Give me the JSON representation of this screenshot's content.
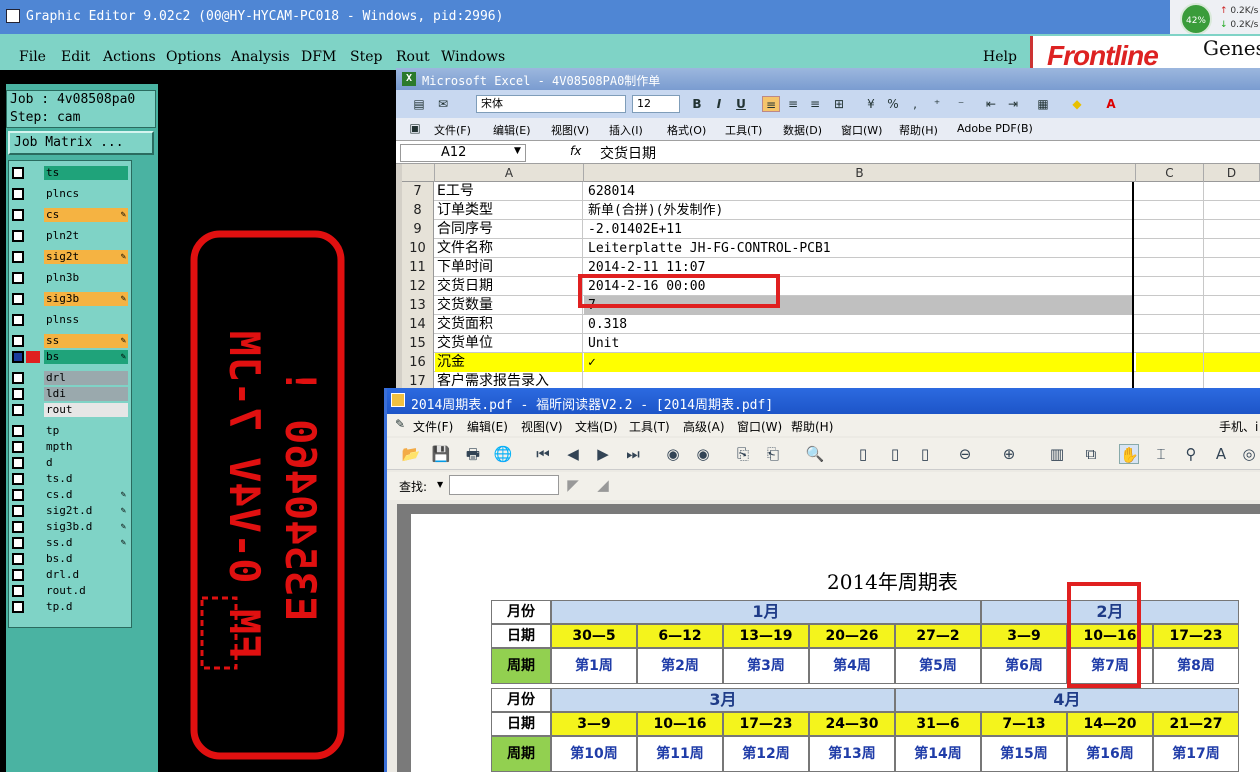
{
  "genesis": {
    "title": "Graphic Editor 9.02c2 (00@HY-HYCAM-PC018 - Windows, pid:2996)",
    "menu": [
      "File",
      "Edit",
      "Actions",
      "Options",
      "Analysis",
      "DFM",
      "Step",
      "Rout",
      "Windows"
    ],
    "help": "Help",
    "logo": "Frontline",
    "logo_genesis": "Genes",
    "job": "Job : 4v08508pa0",
    "step": "Step: cam",
    "job_matrix": "Job Matrix ...",
    "net": {
      "percent": "42%",
      "up": "0.2K/s",
      "down": "0.2K/s"
    },
    "layers": [
      {
        "name": "ts",
        "color": "#1fa37a",
        "pen": false
      },
      {
        "name": "plncs",
        "color": "#7fd3c6",
        "pen": false
      },
      {
        "name": "cs",
        "color": "#f5b342",
        "pen": true
      },
      {
        "name": "pln2t",
        "color": "#7fd3c6",
        "pen": false
      },
      {
        "name": "sig2t",
        "color": "#f5b342",
        "pen": true
      },
      {
        "name": "pln3b",
        "color": "#7fd3c6",
        "pen": false
      },
      {
        "name": "sig3b",
        "color": "#f5b342",
        "pen": true
      },
      {
        "name": "plnss",
        "color": "#7fd3c6",
        "pen": false
      },
      {
        "name": "ss",
        "color": "#f5b342",
        "pen": true
      },
      {
        "name": "bs",
        "color": "#1fa37a",
        "pen": true
      },
      {
        "name": "drl",
        "color": "#9aa9ad",
        "pen": false
      },
      {
        "name": "ldi",
        "color": "#9aa9ad",
        "pen": false
      },
      {
        "name": "rout",
        "color": "#e6e6e6",
        "pen": false
      },
      {
        "name": "tp",
        "color": "#7fd3c6",
        "pen": false
      },
      {
        "name": "mpth",
        "color": "#7fd3c6",
        "pen": false
      },
      {
        "name": "d",
        "color": "#7fd3c6",
        "pen": false
      },
      {
        "name": "ts.d",
        "color": "#7fd3c6",
        "pen": false
      },
      {
        "name": "cs.d",
        "color": "#7fd3c6",
        "pen": true
      },
      {
        "name": "sig2t.d",
        "color": "#7fd3c6",
        "pen": true
      },
      {
        "name": "sig3b.d",
        "color": "#7fd3c6",
        "pen": true
      },
      {
        "name": "ss.d",
        "color": "#7fd3c6",
        "pen": true
      },
      {
        "name": "bs.d",
        "color": "#7fd3c6",
        "pen": false
      },
      {
        "name": "drl.d",
        "color": "#7fd3c6",
        "pen": false
      },
      {
        "name": "rout.d",
        "color": "#7fd3c6",
        "pen": false
      },
      {
        "name": "tp.d",
        "color": "#7fd3c6",
        "pen": false
      }
    ],
    "pcb_text": {
      "line1": "E3540460 ! ",
      "line2": "FM 0-V4V 7-JM"
    }
  },
  "excel": {
    "title": "Microsoft Excel - 4V08508PA0制作单",
    "font": "宋体",
    "size": "12",
    "menu": [
      "文件(F)",
      "编辑(E)",
      "视图(V)",
      "插入(I)",
      "格式(O)",
      "工具(T)",
      "数据(D)",
      "窗口(W)",
      "帮助(H)",
      "Adobe PDF(B)"
    ],
    "name_box": "A12",
    "fx": "fx",
    "formula": "交货日期",
    "columns": [
      "A",
      "B",
      "C",
      "D"
    ],
    "rows": [
      {
        "n": "7",
        "a": "E工号",
        "b": "628014"
      },
      {
        "n": "8",
        "a": "订单类型",
        "b": "新单(合拼)(外发制作)"
      },
      {
        "n": "9",
        "a": "合同序号",
        "b": "-2.01402E+11"
      },
      {
        "n": "10",
        "a": "文件名称",
        "b": "Leiterplatte JH-FG-CONTROL-PCB1"
      },
      {
        "n": "11",
        "a": "下单时间",
        "b": "2014-2-11 11:07"
      },
      {
        "n": "12",
        "a": "交货日期",
        "b": "2014-2-16 00:00"
      },
      {
        "n": "13",
        "a": "交货数量",
        "b": "7"
      },
      {
        "n": "14",
        "a": "交货面积",
        "b": "0.318"
      },
      {
        "n": "15",
        "a": "交货单位",
        "b": "Unit"
      },
      {
        "n": "16",
        "a": "沉金",
        "b": "✓"
      },
      {
        "n": "17",
        "a": "客户需求报告录入",
        "b": ""
      }
    ],
    "colors": {
      "row13_b": "#c0c0c0",
      "row16": "#ffff00"
    }
  },
  "pdf": {
    "title": "2014周期表.pdf - 福昕阅读器V2.2 - [2014周期表.pdf]",
    "menu": [
      "文件(F)",
      "编辑(E)",
      "视图(V)",
      "文档(D)",
      "工具(T)",
      "高级(A)",
      "窗口(W)",
      "帮助(H)"
    ],
    "right_label": "手机、i",
    "find_label": "查找:",
    "calendar": {
      "title": "2014年周期表",
      "labels": {
        "month": "月份",
        "date": "日期",
        "week": "周期"
      },
      "block1": {
        "months": [
          "1月",
          "2月"
        ],
        "dates": [
          "30—5",
          "6—12",
          "13—19",
          "20—26",
          "27—2",
          "3—9",
          "10—16",
          "17—23"
        ],
        "weeks": [
          "第1周",
          "第2周",
          "第3周",
          "第4周",
          "第5周",
          "第6周",
          "第7周",
          "第8周"
        ]
      },
      "block2": {
        "months": [
          "3月",
          "4月"
        ],
        "dates": [
          "3—9",
          "10—16",
          "17—23",
          "24—30",
          "31—6",
          "7—13",
          "14—20",
          "21—27"
        ],
        "weeks": [
          "第10周",
          "第11周",
          "第12周",
          "第13周",
          "第14周",
          "第15周",
          "第16周",
          "第17周"
        ]
      }
    }
  }
}
